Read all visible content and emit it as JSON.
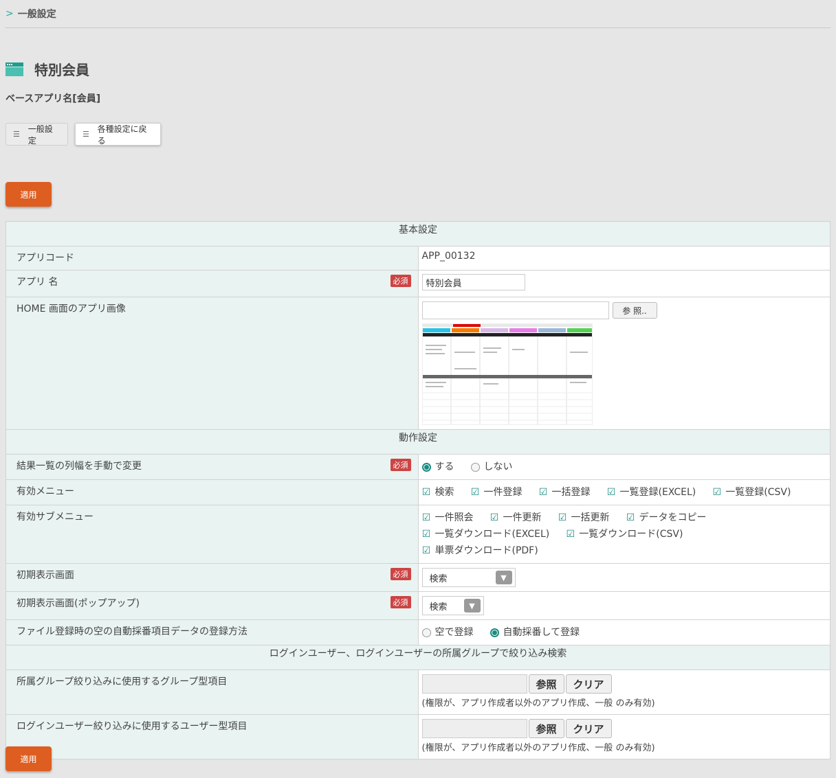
{
  "breadcrumb": {
    "label": "一般設定"
  },
  "page": {
    "title": "特別会員",
    "base_app": "ベースアプリ名[会員]"
  },
  "tabs": [
    {
      "label": "一般設定"
    },
    {
      "label": "各種設定に戻る"
    }
  ],
  "apply_label": "適用",
  "sections": {
    "basic": "基本設定",
    "behavior": "動作設定",
    "login_filter": "ログインユーザー、ログインユーザーの所属グループで絞り込み検索"
  },
  "required_badge": "必須",
  "rows": {
    "app_code": {
      "label": "アプリコード",
      "value": "APP_00132"
    },
    "app_name": {
      "label": "アプリ 名",
      "value": "特別会員"
    },
    "home_image": {
      "label": "HOME 画面のアプリ画像",
      "browse_label": "参 照.."
    },
    "column_width": {
      "label": "結果一覧の列幅を手動で変更",
      "options": [
        "する",
        "しない"
      ],
      "selected": "する"
    },
    "menu": {
      "label": "有効メニュー",
      "options": [
        "検索",
        "一件登録",
        "一括登録",
        "一覧登録(EXCEL)",
        "一覧登録(CSV)"
      ]
    },
    "submenu": {
      "label": "有効サブメニュー",
      "options": [
        "一件照会",
        "一件更新",
        "一括更新",
        "データをコピー",
        "一覧ダウンロード(EXCEL)",
        "一覧ダウンロード(CSV)",
        "単票ダウンロード(PDF)"
      ]
    },
    "initial_screen": {
      "label": "初期表示画面",
      "value": "検索"
    },
    "initial_popup": {
      "label": "初期表示画面(ポップアップ)",
      "value": "検索"
    },
    "auto_number": {
      "label": "ファイル登録時の空の自動採番項目データの登録方法",
      "options": [
        "空で登録",
        "自動採番して登録"
      ],
      "selected": "自動採番して登録"
    },
    "group_item": {
      "label": "所属グループ絞り込みに使用するグループ型項目",
      "ref_label": "参照",
      "clear_label": "クリア",
      "note": "(権限が、アプリ作成者以外のアプリ作成、一般 のみ有効)"
    },
    "user_item": {
      "label": "ログインユーザー絞り込みに使用するユーザー型項目",
      "ref_label": "参照",
      "clear_label": "クリア",
      "note": "(権限が、アプリ作成者以外のアプリ作成、一般 のみ有効)"
    }
  }
}
